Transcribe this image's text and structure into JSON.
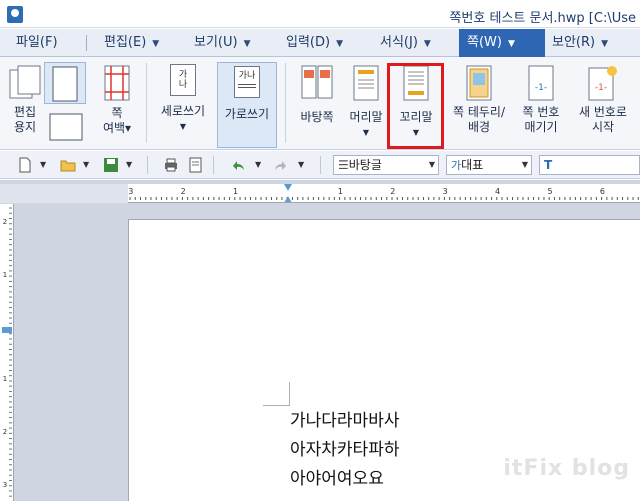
{
  "window": {
    "title": "쪽번호 테스트 문서.hwp [C:\\Use"
  },
  "menu": {
    "items": [
      {
        "label": "파일(F)"
      },
      {
        "label": "편집(E)"
      },
      {
        "label": "보기(U)"
      },
      {
        "label": "입력(D)"
      },
      {
        "label": "서식(J)"
      },
      {
        "label": "쪽(W)"
      },
      {
        "label": "보안(R)"
      }
    ],
    "active_index": 5
  },
  "ribbon": {
    "edit_paper_label": "편집\n용지",
    "page_margin_label": "쪽\n여백▾",
    "vertical_label": "세로쓰기",
    "vertical_icon_text": "가\n나",
    "horizontal_label": "가로쓰기",
    "horizontal_icon_text": "가나",
    "background_page_label": "바탕쪽",
    "header_label": "머리말",
    "footer_label": "꼬리말",
    "border_bg_label": "쪽 테두리/\n배경",
    "page_number_label": "쪽 번호\n매기기",
    "new_number_label": "새 번호로\n시작",
    "page_number_icon_text": "-1-"
  },
  "toolbar": {
    "style_value": "바탕글",
    "font_type_value": "대표",
    "font_type_icon": "가"
  },
  "ruler": {
    "top_labels": [
      "3",
      "2",
      "1",
      "1",
      "2",
      "3",
      "4",
      "5",
      "6"
    ],
    "side_labels": [
      "2",
      "1",
      "1",
      "2",
      "3"
    ]
  },
  "document": {
    "lines": [
      "가나다라마바사",
      "아자차카타파하",
      "아야어여오요"
    ]
  },
  "watermark": "itFix blog",
  "colors": {
    "menu_active": "#2f66b3",
    "highlight_frame": "#e0191c"
  }
}
